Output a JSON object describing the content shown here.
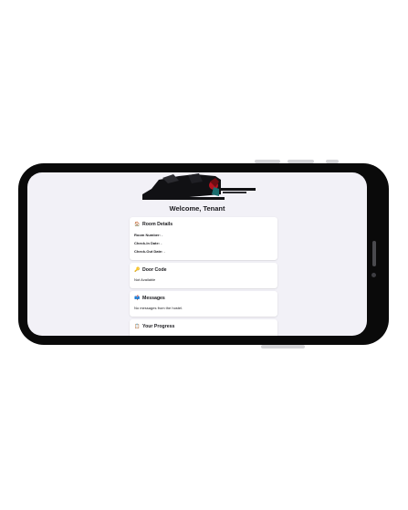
{
  "screen": {
    "welcome_title": "Welcome, Tenant"
  },
  "cards": {
    "room_details": {
      "icon": "house-icon",
      "title": "Room Details",
      "room_number_label": "Room Number:",
      "room_number_value": "-",
      "check_in_label": "Check-In Date:",
      "check_in_value": "-",
      "check_out_label": "Check-Out Date:",
      "check_out_value": "-"
    },
    "door_code": {
      "icon": "key-icon",
      "title": "Door Code",
      "value": "Not Available"
    },
    "messages": {
      "icon": "mailbox-icon",
      "title": "Messages",
      "value": "No messages from the hostel."
    },
    "progress": {
      "icon": "clipboard-icon",
      "title": "Your Progress"
    }
  },
  "colors": {
    "screen_bg": "#f2f1f7",
    "card_bg": "#ffffff",
    "frame": "#0a0a0a",
    "text": "#1b1b1f"
  }
}
